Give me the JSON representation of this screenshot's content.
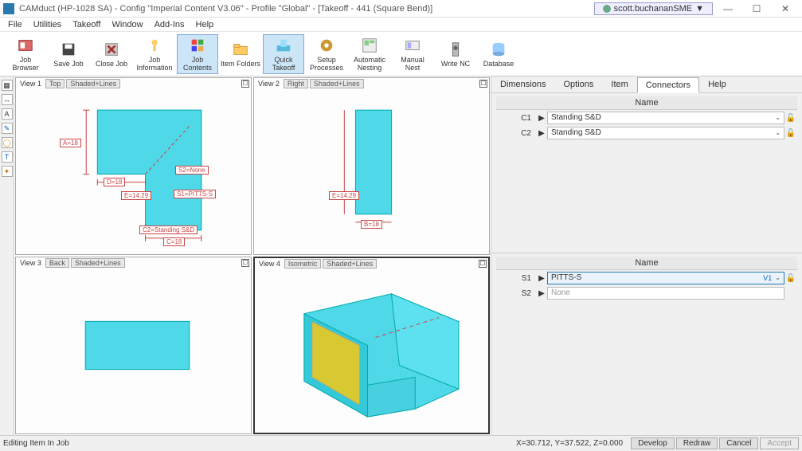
{
  "title": "CAMduct (HP-1028 SA) - Config \"Imperial Content V3.06\" - Profile \"Global\" - [Takeoff - 441 (Square Bend)]",
  "user": "scott.buchananSME",
  "menu": [
    "File",
    "Utilities",
    "Takeoff",
    "Window",
    "Add-Ins",
    "Help"
  ],
  "toolbar": [
    {
      "label": "Job Browser"
    },
    {
      "label": "Save Job"
    },
    {
      "label": "Close Job"
    },
    {
      "label": "Job Information"
    },
    {
      "label": "Job Contents",
      "active": true
    },
    {
      "label": "Item Folders"
    },
    {
      "label": "Quick Takeoff",
      "active": true
    },
    {
      "label": "Setup Processes"
    },
    {
      "label": "Automatic Nesting"
    },
    {
      "label": "Manual Nest"
    },
    {
      "label": "Write NC"
    },
    {
      "label": "Database"
    }
  ],
  "views": {
    "v1": {
      "name": "View 1",
      "mode1": "Top",
      "mode2": "Shaded+Lines",
      "dims": {
        "A": "A=18",
        "D": "D=18",
        "E": "E=14.29",
        "S1": "S1=PITTS-S",
        "S2": "S2=None",
        "C2": "C2=Standing S&D",
        "C": "C=18"
      }
    },
    "v2": {
      "name": "View 2",
      "mode1": "Right",
      "mode2": "Shaded+Lines",
      "dims": {
        "E": "E=14.29",
        "B": "B=18"
      }
    },
    "v3": {
      "name": "View 3",
      "mode1": "Back",
      "mode2": "Shaded+Lines"
    },
    "v4": {
      "name": "View 4",
      "mode1": "Isometric",
      "mode2": "Shaded+Lines"
    }
  },
  "prop_tabs": [
    "Dimensions",
    "Options",
    "Item",
    "Connectors",
    "Help"
  ],
  "prop_active": "Connectors",
  "connectors_header": "Name",
  "connectors": {
    "C1": {
      "label": "C1",
      "value": "Standing S&D"
    },
    "C2": {
      "label": "C2",
      "value": "Standing S&D"
    }
  },
  "seams_header": "Name",
  "seams": {
    "S1": {
      "label": "S1",
      "value": "PITTS-S",
      "badge": "V1"
    },
    "S2": {
      "label": "S2",
      "value": "None"
    }
  },
  "status": {
    "left": "Editing Item In Job",
    "coords": "X=30.712, Y=37.522, Z=0.000",
    "buttons": [
      "Develop",
      "Redraw",
      "Cancel",
      "Accept"
    ]
  }
}
